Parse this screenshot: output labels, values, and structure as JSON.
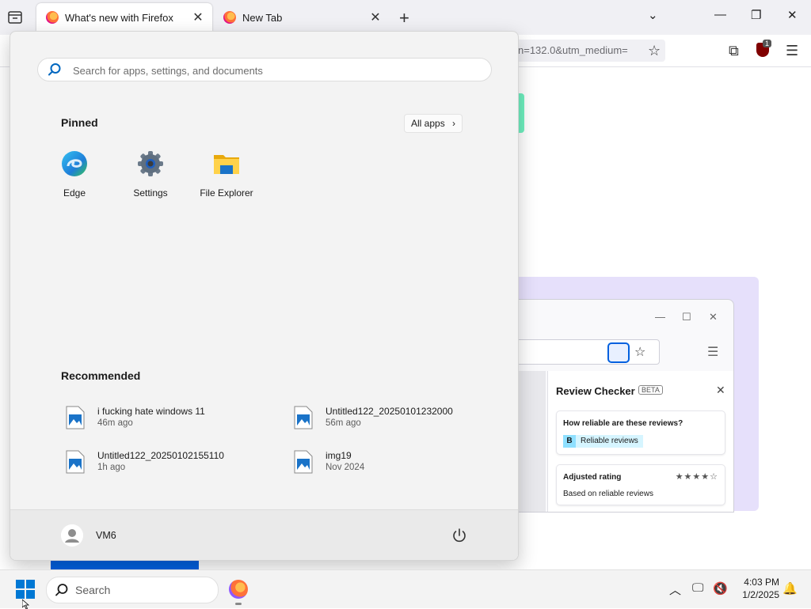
{
  "browser": {
    "tabs": [
      {
        "title": "What's new with Firefox",
        "active": true
      },
      {
        "title": "New Tab",
        "active": false
      }
    ],
    "url_fragment": "n=132.0&utm_medium=",
    "ublock_count": "1"
  },
  "start_menu": {
    "search_placeholder": "Search for apps, settings, and documents",
    "pinned_title": "Pinned",
    "all_apps_label": "All apps",
    "pinned": [
      {
        "label": "Edge",
        "icon": "edge-icon"
      },
      {
        "label": "Settings",
        "icon": "settings-gear-icon"
      },
      {
        "label": "File Explorer",
        "icon": "folder-icon"
      }
    ],
    "recommended_title": "Recommended",
    "recommended": [
      {
        "name": "i fucking hate windows 11",
        "time": "46m ago"
      },
      {
        "name": "Untitled122_20250101232000",
        "time": "56m ago"
      },
      {
        "name": "Untitled122_20250102155110",
        "time": "1h ago"
      },
      {
        "name": "img19",
        "time": "Nov 2024"
      }
    ],
    "user_name": "VM6"
  },
  "page_preview": {
    "review_checker_title": "Review Checker",
    "beta_label": "BETA",
    "card1_heading": "How reliable are these reviews?",
    "card1_grade": "B",
    "card1_badge": "Reliable reviews",
    "card2_heading": "Adjusted rating",
    "card2_sub": "Based on reliable reviews",
    "stars": "★★★★☆"
  },
  "taskbar": {
    "search_label": "Search",
    "time": "4:03 PM",
    "date": "1/2/2025"
  },
  "colors": {
    "accent_blue": "#0060df",
    "windows_blue": "#0078d4"
  }
}
